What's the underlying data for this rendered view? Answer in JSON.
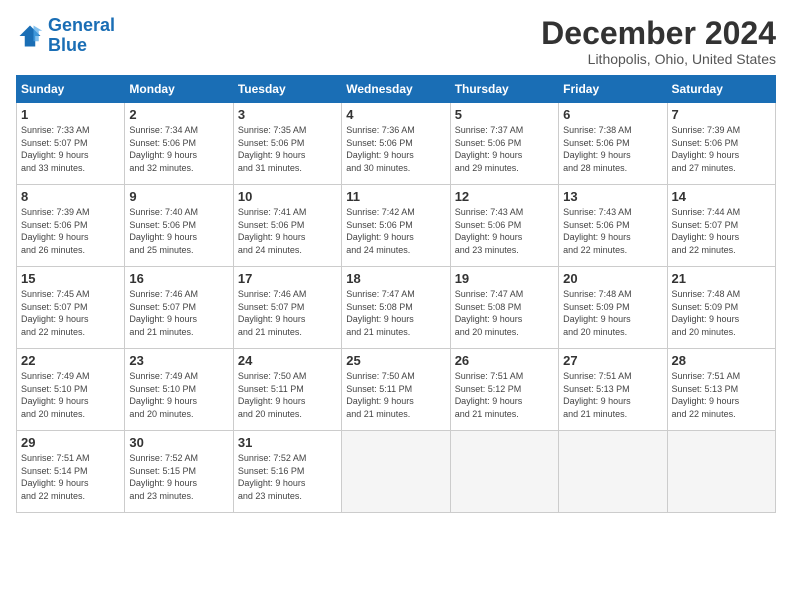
{
  "logo": {
    "line1": "General",
    "line2": "Blue"
  },
  "title": "December 2024",
  "location": "Lithopolis, Ohio, United States",
  "weekdays": [
    "Sunday",
    "Monday",
    "Tuesday",
    "Wednesday",
    "Thursday",
    "Friday",
    "Saturday"
  ],
  "weeks": [
    [
      {
        "day": "1",
        "info": "Sunrise: 7:33 AM\nSunset: 5:07 PM\nDaylight: 9 hours\nand 33 minutes."
      },
      {
        "day": "2",
        "info": "Sunrise: 7:34 AM\nSunset: 5:06 PM\nDaylight: 9 hours\nand 32 minutes."
      },
      {
        "day": "3",
        "info": "Sunrise: 7:35 AM\nSunset: 5:06 PM\nDaylight: 9 hours\nand 31 minutes."
      },
      {
        "day": "4",
        "info": "Sunrise: 7:36 AM\nSunset: 5:06 PM\nDaylight: 9 hours\nand 30 minutes."
      },
      {
        "day": "5",
        "info": "Sunrise: 7:37 AM\nSunset: 5:06 PM\nDaylight: 9 hours\nand 29 minutes."
      },
      {
        "day": "6",
        "info": "Sunrise: 7:38 AM\nSunset: 5:06 PM\nDaylight: 9 hours\nand 28 minutes."
      },
      {
        "day": "7",
        "info": "Sunrise: 7:39 AM\nSunset: 5:06 PM\nDaylight: 9 hours\nand 27 minutes."
      }
    ],
    [
      {
        "day": "8",
        "info": "Sunrise: 7:39 AM\nSunset: 5:06 PM\nDaylight: 9 hours\nand 26 minutes."
      },
      {
        "day": "9",
        "info": "Sunrise: 7:40 AM\nSunset: 5:06 PM\nDaylight: 9 hours\nand 25 minutes."
      },
      {
        "day": "10",
        "info": "Sunrise: 7:41 AM\nSunset: 5:06 PM\nDaylight: 9 hours\nand 24 minutes."
      },
      {
        "day": "11",
        "info": "Sunrise: 7:42 AM\nSunset: 5:06 PM\nDaylight: 9 hours\nand 24 minutes."
      },
      {
        "day": "12",
        "info": "Sunrise: 7:43 AM\nSunset: 5:06 PM\nDaylight: 9 hours\nand 23 minutes."
      },
      {
        "day": "13",
        "info": "Sunrise: 7:43 AM\nSunset: 5:06 PM\nDaylight: 9 hours\nand 22 minutes."
      },
      {
        "day": "14",
        "info": "Sunrise: 7:44 AM\nSunset: 5:07 PM\nDaylight: 9 hours\nand 22 minutes."
      }
    ],
    [
      {
        "day": "15",
        "info": "Sunrise: 7:45 AM\nSunset: 5:07 PM\nDaylight: 9 hours\nand 22 minutes."
      },
      {
        "day": "16",
        "info": "Sunrise: 7:46 AM\nSunset: 5:07 PM\nDaylight: 9 hours\nand 21 minutes."
      },
      {
        "day": "17",
        "info": "Sunrise: 7:46 AM\nSunset: 5:07 PM\nDaylight: 9 hours\nand 21 minutes."
      },
      {
        "day": "18",
        "info": "Sunrise: 7:47 AM\nSunset: 5:08 PM\nDaylight: 9 hours\nand 21 minutes."
      },
      {
        "day": "19",
        "info": "Sunrise: 7:47 AM\nSunset: 5:08 PM\nDaylight: 9 hours\nand 20 minutes."
      },
      {
        "day": "20",
        "info": "Sunrise: 7:48 AM\nSunset: 5:09 PM\nDaylight: 9 hours\nand 20 minutes."
      },
      {
        "day": "21",
        "info": "Sunrise: 7:48 AM\nSunset: 5:09 PM\nDaylight: 9 hours\nand 20 minutes."
      }
    ],
    [
      {
        "day": "22",
        "info": "Sunrise: 7:49 AM\nSunset: 5:10 PM\nDaylight: 9 hours\nand 20 minutes."
      },
      {
        "day": "23",
        "info": "Sunrise: 7:49 AM\nSunset: 5:10 PM\nDaylight: 9 hours\nand 20 minutes."
      },
      {
        "day": "24",
        "info": "Sunrise: 7:50 AM\nSunset: 5:11 PM\nDaylight: 9 hours\nand 20 minutes."
      },
      {
        "day": "25",
        "info": "Sunrise: 7:50 AM\nSunset: 5:11 PM\nDaylight: 9 hours\nand 21 minutes."
      },
      {
        "day": "26",
        "info": "Sunrise: 7:51 AM\nSunset: 5:12 PM\nDaylight: 9 hours\nand 21 minutes."
      },
      {
        "day": "27",
        "info": "Sunrise: 7:51 AM\nSunset: 5:13 PM\nDaylight: 9 hours\nand 21 minutes."
      },
      {
        "day": "28",
        "info": "Sunrise: 7:51 AM\nSunset: 5:13 PM\nDaylight: 9 hours\nand 22 minutes."
      }
    ],
    [
      {
        "day": "29",
        "info": "Sunrise: 7:51 AM\nSunset: 5:14 PM\nDaylight: 9 hours\nand 22 minutes."
      },
      {
        "day": "30",
        "info": "Sunrise: 7:52 AM\nSunset: 5:15 PM\nDaylight: 9 hours\nand 23 minutes."
      },
      {
        "day": "31",
        "info": "Sunrise: 7:52 AM\nSunset: 5:16 PM\nDaylight: 9 hours\nand 23 minutes."
      },
      {
        "day": "",
        "info": ""
      },
      {
        "day": "",
        "info": ""
      },
      {
        "day": "",
        "info": ""
      },
      {
        "day": "",
        "info": ""
      }
    ]
  ]
}
